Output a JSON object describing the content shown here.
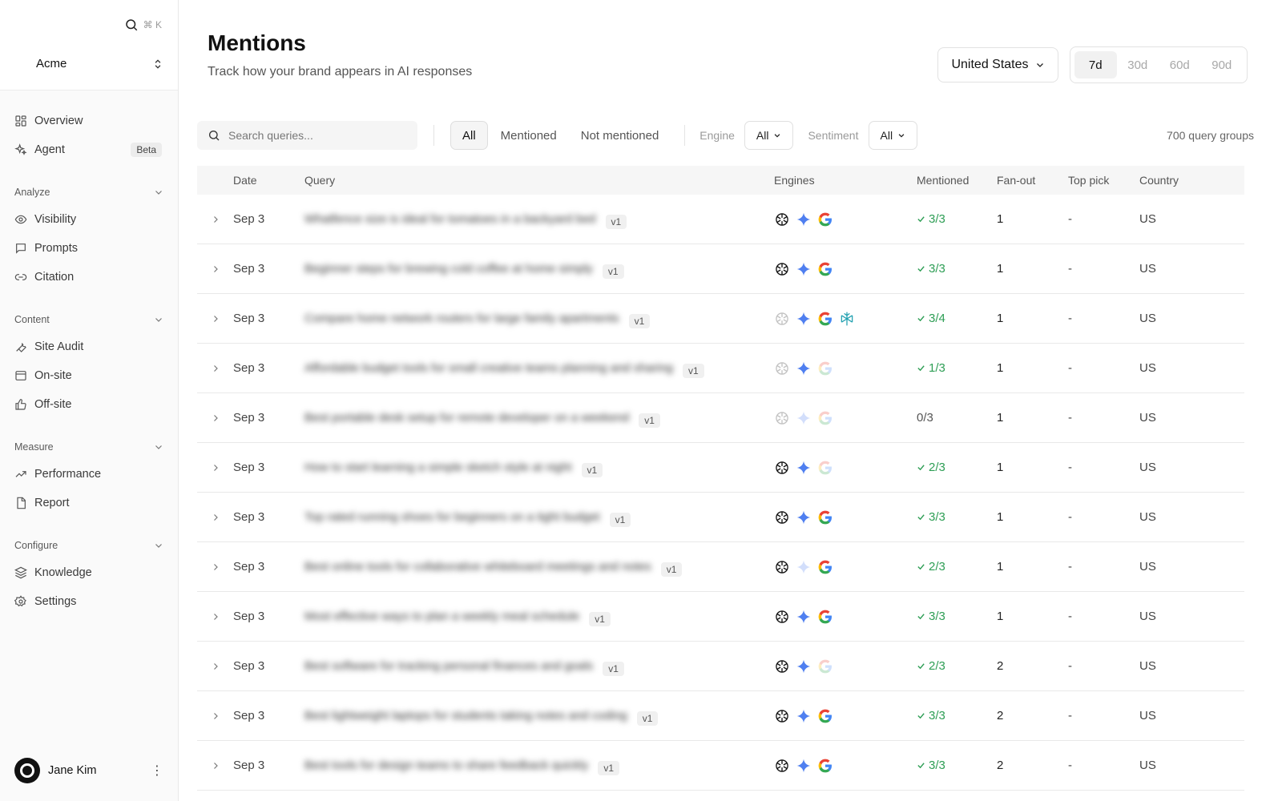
{
  "sidebar": {
    "search_shortcut": "⌘ K",
    "workspace": "Acme",
    "top_items": [
      {
        "label": "Overview",
        "icon": "layout-icon"
      },
      {
        "label": "Agent",
        "icon": "sparkles-icon",
        "badge": "Beta"
      }
    ],
    "sections": [
      {
        "title": "Analyze",
        "items": [
          {
            "label": "Visibility",
            "icon": "eye-icon"
          },
          {
            "label": "Prompts",
            "icon": "message-icon"
          },
          {
            "label": "Citation",
            "icon": "link-icon"
          }
        ]
      },
      {
        "title": "Content",
        "items": [
          {
            "label": "Site Audit",
            "icon": "wrench-icon"
          },
          {
            "label": "On-site",
            "icon": "browser-icon"
          },
          {
            "label": "Off-site",
            "icon": "thumbs-up-icon"
          }
        ]
      },
      {
        "title": "Measure",
        "items": [
          {
            "label": "Performance",
            "icon": "trend-icon"
          },
          {
            "label": "Report",
            "icon": "file-icon"
          }
        ]
      },
      {
        "title": "Configure",
        "items": [
          {
            "label": "Knowledge",
            "icon": "layers-icon"
          },
          {
            "label": "Settings",
            "icon": "gear-icon"
          }
        ]
      }
    ],
    "user": {
      "name": "Jane Kim"
    }
  },
  "header": {
    "title": "Mentions",
    "subtitle": "Track how your brand appears in AI responses",
    "country": "United States",
    "ranges": [
      "7d",
      "30d",
      "60d",
      "90d"
    ],
    "active_range": "7d"
  },
  "filters": {
    "search_placeholder": "Search queries...",
    "segments": [
      "All",
      "Mentioned",
      "Not mentioned"
    ],
    "active_segment": "All",
    "engine_label": "Engine",
    "engine_value": "All",
    "sentiment_label": "Sentiment",
    "sentiment_value": "All",
    "count": "700 query groups"
  },
  "table": {
    "columns": [
      "Date",
      "Query",
      "Engines",
      "Mentioned",
      "Fan-out",
      "Top pick",
      "Country"
    ],
    "rows": [
      {
        "date": "Sep 3",
        "query": "Whatfence size is ideal for tomatoes in a backyard bed",
        "version": "v1",
        "engines": [
          true,
          true,
          true
        ],
        "mentioned": "3/3",
        "ok": true,
        "fanout": "1",
        "top": "-",
        "country": "US"
      },
      {
        "date": "Sep 3",
        "query": "Beginner steps for brewing cold coffee at home simply",
        "version": "v1",
        "engines": [
          true,
          true,
          true
        ],
        "mentioned": "3/3",
        "ok": true,
        "fanout": "1",
        "top": "-",
        "country": "US"
      },
      {
        "date": "Sep 3",
        "query": "Compare home network routers for large family apartments",
        "version": "v1",
        "engines": [
          false,
          true,
          true,
          true
        ],
        "mentioned": "3/4",
        "ok": true,
        "fanout": "1",
        "top": "-",
        "country": "US"
      },
      {
        "date": "Sep 3",
        "query": "Affordable budget tools for small creative teams planning and sharing",
        "version": "v1",
        "engines": [
          false,
          true,
          false
        ],
        "mentioned": "1/3",
        "ok": true,
        "fanout": "1",
        "top": "-",
        "country": "US"
      },
      {
        "date": "Sep 3",
        "query": "Best portable desk setup for remote developer on a weekend",
        "version": "v1",
        "engines": [
          false,
          false,
          false
        ],
        "mentioned": "0/3",
        "ok": false,
        "fanout": "1",
        "top": "-",
        "country": "US"
      },
      {
        "date": "Sep 3",
        "query": "How to start learning a simple sketch style at night",
        "version": "v1",
        "engines": [
          true,
          true,
          false
        ],
        "mentioned": "2/3",
        "ok": true,
        "fanout": "1",
        "top": "-",
        "country": "US"
      },
      {
        "date": "Sep 3",
        "query": "Top rated running shoes for beginners on a tight budget",
        "version": "v1",
        "engines": [
          true,
          true,
          true
        ],
        "mentioned": "3/3",
        "ok": true,
        "fanout": "1",
        "top": "-",
        "country": "US"
      },
      {
        "date": "Sep 3",
        "query": "Best online tools for collaborative whiteboard meetings and notes",
        "version": "v1",
        "engines": [
          true,
          false,
          true
        ],
        "mentioned": "2/3",
        "ok": true,
        "fanout": "1",
        "top": "-",
        "country": "US"
      },
      {
        "date": "Sep 3",
        "query": "Most effective ways to plan a weekly meal schedule",
        "version": "v1",
        "engines": [
          true,
          true,
          true
        ],
        "mentioned": "3/3",
        "ok": true,
        "fanout": "1",
        "top": "-",
        "country": "US"
      },
      {
        "date": "Sep 3",
        "query": "Best software for tracking personal finances and goals",
        "version": "v1",
        "engines": [
          true,
          true,
          false
        ],
        "mentioned": "2/3",
        "ok": true,
        "fanout": "2",
        "top": "-",
        "country": "US"
      },
      {
        "date": "Sep 3",
        "query": "Best lightweight laptops for students taking notes and coding",
        "version": "v1",
        "engines": [
          true,
          true,
          true
        ],
        "mentioned": "3/3",
        "ok": true,
        "fanout": "2",
        "top": "-",
        "country": "US"
      },
      {
        "date": "Sep 3",
        "query": "Best tools for design teams to share feedback quickly",
        "version": "v1",
        "engines": [
          true,
          true,
          true
        ],
        "mentioned": "3/3",
        "ok": true,
        "fanout": "2",
        "top": "-",
        "country": "US"
      }
    ]
  },
  "colors": {
    "accent_green": "#2e9e55",
    "gemini_blue": "#4f7ff0"
  },
  "engine_icons": [
    "openai-icon",
    "gemini-icon",
    "google-icon",
    "perplexity-icon"
  ]
}
